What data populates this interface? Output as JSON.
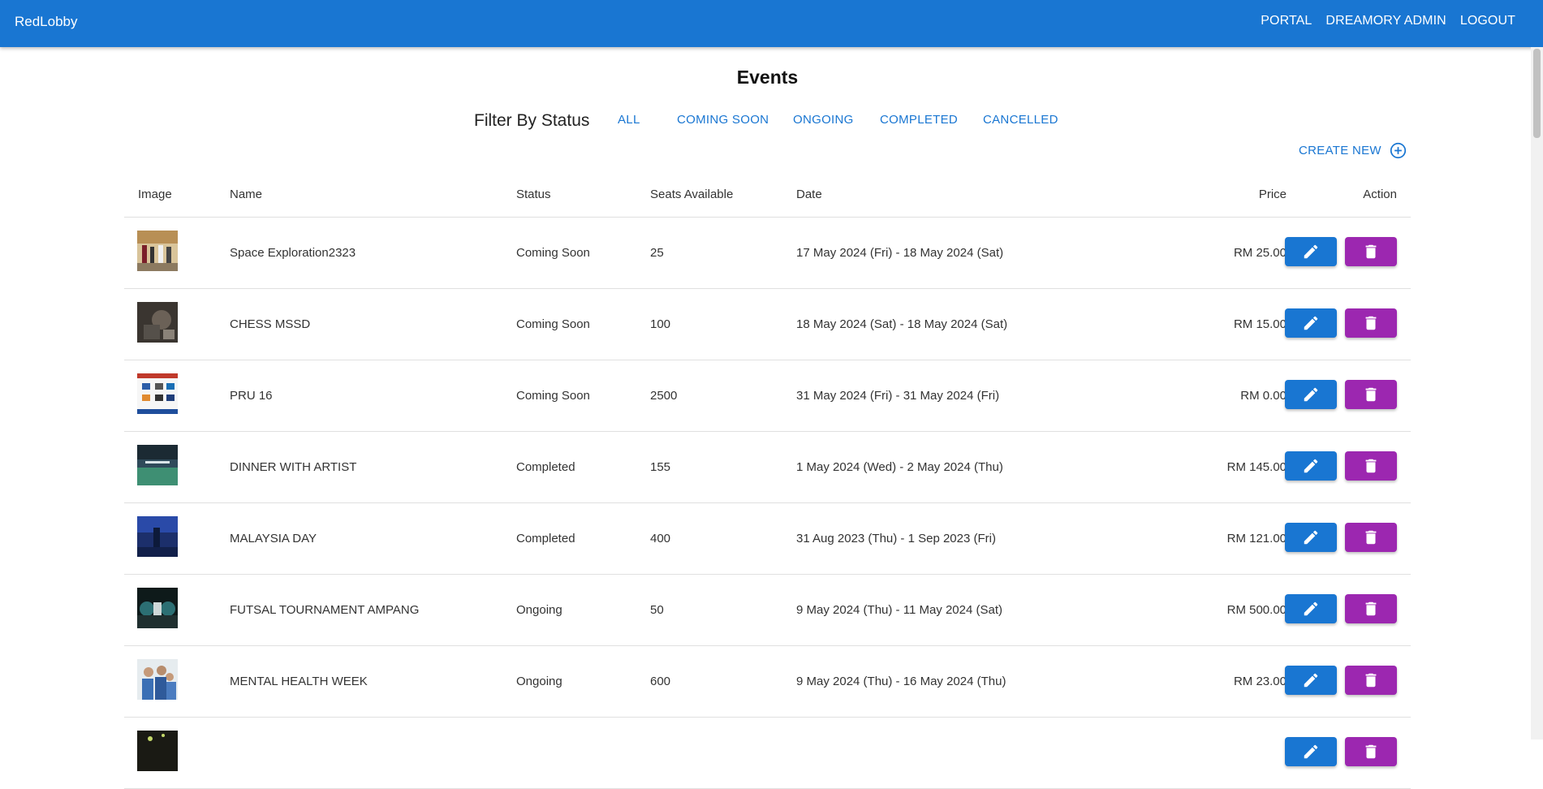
{
  "app": {
    "brand": "RedLobby"
  },
  "nav": {
    "portal": "PORTAL",
    "admin": "DREAMORY ADMIN",
    "logout": "LOGOUT"
  },
  "page": {
    "title": "Events"
  },
  "filter": {
    "label": "Filter By Status",
    "options": [
      "ALL",
      "COMING SOON",
      "ONGOING",
      "COMPLETED",
      "CANCELLED"
    ]
  },
  "create_new": {
    "label": "CREATE NEW",
    "icon": "add-circle-icon"
  },
  "table": {
    "headers": {
      "image": "Image",
      "name": "Name",
      "status": "Status",
      "seats": "Seats Available",
      "date": "Date",
      "price": "Price",
      "action": "Action"
    },
    "rows": [
      {
        "name": "Space Exploration2323",
        "status": "Coming Soon",
        "seats": "25",
        "date": "17 May 2024 (Fri) - 18 May 2024 (Sat)",
        "price": "RM 25.00"
      },
      {
        "name": "CHESS MSSD",
        "status": "Coming Soon",
        "seats": "100",
        "date": "18 May 2024 (Sat) - 18 May 2024 (Sat)",
        "price": "RM 15.00"
      },
      {
        "name": "PRU 16",
        "status": "Coming Soon",
        "seats": "2500",
        "date": "31 May 2024 (Fri) - 31 May 2024 (Fri)",
        "price": "RM 0.00"
      },
      {
        "name": "DINNER WITH ARTIST",
        "status": "Completed",
        "seats": "155",
        "date": "1 May 2024 (Wed) - 2 May 2024 (Thu)",
        "price": "RM 145.00"
      },
      {
        "name": "MALAYSIA DAY",
        "status": "Completed",
        "seats": "400",
        "date": "31 Aug 2023 (Thu) - 1 Sep 2023 (Fri)",
        "price": "RM 121.00"
      },
      {
        "name": "FUTSAL TOURNAMENT AMPANG",
        "status": "Ongoing",
        "seats": "50",
        "date": "9 May 2024 (Thu) - 11 May 2024 (Sat)",
        "price": "RM 500.00"
      },
      {
        "name": "MENTAL HEALTH WEEK",
        "status": "Ongoing",
        "seats": "600",
        "date": "9 May 2024 (Thu) - 16 May 2024 (Thu)",
        "price": "RM 23.00"
      },
      {
        "name": "",
        "status": "",
        "seats": "",
        "date": "",
        "price": ""
      }
    ]
  },
  "colors": {
    "primary": "#1976d2",
    "delete": "#9c27b0"
  }
}
